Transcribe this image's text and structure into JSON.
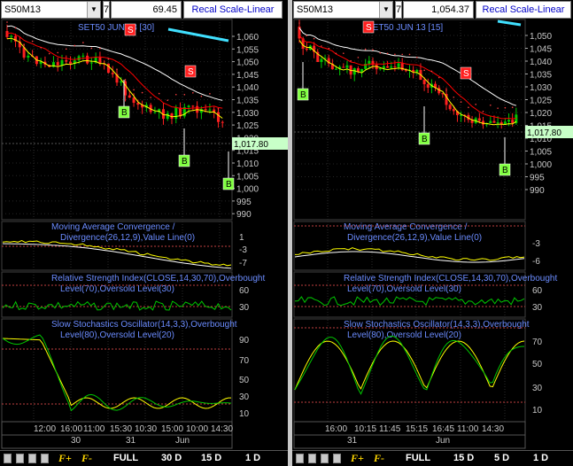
{
  "left": {
    "symbol": "S50M13",
    "seven": "7",
    "price_field": "69.45",
    "recal": "Recal Scale-Linear",
    "chart_title": "SET50 JUN 13 [30]",
    "current_price": "1,017.80",
    "y_ticks": [
      "1,060",
      "1,055",
      "1,050",
      "1,045",
      "1,040",
      "1,035",
      "1,030",
      "1,025",
      "1,020",
      "1,015",
      "1,010",
      "1,005",
      "1,000",
      "995",
      "990"
    ],
    "macd_title": [
      "Moving Average Convergence /",
      "Divergence(26,12,9),Value Line(0)"
    ],
    "macd_ticks": [
      "1",
      "-3",
      "-7"
    ],
    "rsi_title": [
      "Relative Strength Index(CLOSE,14,30,70),Overbought",
      "Level(70),Oversold Level(30)"
    ],
    "rsi_ticks": [
      "60",
      "30"
    ],
    "stoch_title": [
      "Slow Stochastics Oscillator(14,3,3),Overbought",
      "Level(80),Oversold Level(20)"
    ],
    "stoch_ticks": [
      "90",
      "70",
      "50",
      "30",
      "10"
    ],
    "time_labels": [
      "12:00",
      "16:00",
      "11:00",
      "15:30",
      "10:30",
      "15:00",
      "10:00",
      "14:30"
    ],
    "date_labels": [
      "30",
      "31",
      "Jun"
    ],
    "signals": [
      {
        "t": "S",
        "kind": "sell"
      },
      {
        "t": "S",
        "kind": "sell"
      },
      {
        "t": "B",
        "kind": "buy"
      },
      {
        "t": "B",
        "kind": "buy"
      },
      {
        "t": "B",
        "kind": "buy"
      }
    ],
    "buttons": [
      "FULL",
      "30 D",
      "15 D",
      "1 D"
    ]
  },
  "right": {
    "symbol": "S50M13",
    "seven": "7",
    "price_field": "1,054.37",
    "recal": "Recal Scale-Linear",
    "chart_title": "SET50 JUN 13 [15]",
    "current_price": "1,017.80",
    "y_ticks": [
      "1,050",
      "1,045",
      "1,040",
      "1,035",
      "1,030",
      "1,025",
      "1,020",
      "1,015",
      "1,010",
      "1,005",
      "1,000",
      "995",
      "990"
    ],
    "macd_title": [
      "Moving Average Convergence /",
      "Divergence(26,12,9),Value Line(0)"
    ],
    "macd_ticks": [
      "-3",
      "-6"
    ],
    "rsi_title": [
      "Relative Strength Index(CLOSE,14,30,70),Overbought",
      "Level(70),Oversold Level(30)"
    ],
    "rsi_ticks": [
      "60",
      "30"
    ],
    "stoch_title": [
      "Slow Stochastics Oscillator(14,3,3),Overbought",
      "Level(80),Oversold Level(20)"
    ],
    "stoch_ticks": [
      "70",
      "50",
      "30",
      "10"
    ],
    "time_labels": [
      "16:00",
      "10:15",
      "11:45",
      "15:15",
      "16:45",
      "11:00",
      "14:30"
    ],
    "date_labels": [
      "31",
      "Jun"
    ],
    "signals": [
      {
        "t": "S",
        "kind": "sell"
      },
      {
        "t": "S",
        "kind": "sell"
      },
      {
        "t": "B",
        "kind": "buy"
      },
      {
        "t": "B",
        "kind": "buy"
      },
      {
        "t": "B",
        "kind": "buy"
      }
    ],
    "buttons": [
      "FULL",
      "15 D",
      "5 D",
      "1 D"
    ]
  },
  "colors": {
    "up": "#00c800",
    "down": "#ff2020",
    "ma1": "#ffff00",
    "ma2": "#ff0000",
    "ma3": "#ffffff",
    "grid": "#3a3a3a",
    "buy": "#80ff40",
    "sell": "#ff2020",
    "title": "#6b8cff"
  }
}
